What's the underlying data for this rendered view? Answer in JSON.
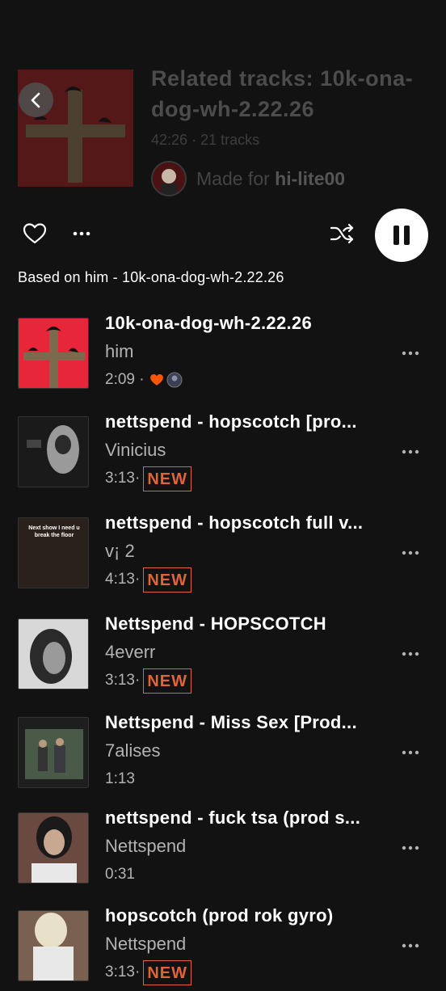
{
  "playlist": {
    "title": "Related tracks: 10k-ona-dog-wh-2.22.26",
    "duration": "42:26",
    "separator": "·",
    "track_count": "21 tracks",
    "made_for_prefix": "Made for",
    "made_for_user": "hi-lite00"
  },
  "based_on": "Based on him - 10k-ona-dog-wh-2.22.26",
  "tracks": [
    {
      "title": "10k-ona-dog-wh-2.22.26",
      "artist": "him",
      "duration": "2:09 ·",
      "badge": ""
    },
    {
      "title": "nettspend - hopscotch [pro...",
      "artist": "Vinicius",
      "duration": "3:13·",
      "badge": "NEW"
    },
    {
      "title": "nettspend - hopscotch full v...",
      "artist": "v¡ 2",
      "duration": "4:13·",
      "badge": "NEW"
    },
    {
      "title": "Nettspend - HOPSCOTCH",
      "artist": "4everr",
      "duration": "3:13·",
      "badge": "NEW"
    },
    {
      "title": "Nettspend - Miss Sex [Prod...",
      "artist": "7alises",
      "duration": "1:13",
      "badge": ""
    },
    {
      "title": "nettspend - fuck tsa (prod s...",
      "artist": "Nettspend",
      "duration": "0:31",
      "badge": ""
    },
    {
      "title": "hopscotch (prod rok gyro)",
      "artist": "Nettspend",
      "duration": "3:13·",
      "badge": "NEW"
    }
  ],
  "thumb3_caption": "Next show I need u break the floor",
  "icons": {
    "back": "chevron-left-icon",
    "like": "heart-outline-icon",
    "more": "more-horizontal-icon",
    "shuffle": "shuffle-icon",
    "pause": "pause-icon",
    "liked": "heart-filled-icon",
    "listener": "avatar-icon"
  },
  "colors": {
    "background": "#121212",
    "text_primary": "#ffffff",
    "text_secondary": "#b3b3b3",
    "accent_new": "#e0643a",
    "accent_heart": "#ff5500"
  }
}
